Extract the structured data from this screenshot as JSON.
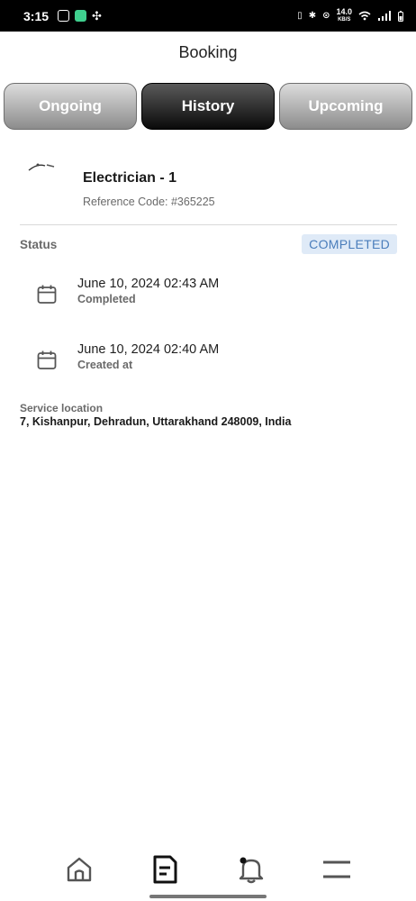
{
  "status_bar": {
    "time": "3:15",
    "speed_value": "14.0",
    "speed_unit": "KB/S"
  },
  "header": {
    "title": "Booking"
  },
  "tabs": [
    {
      "label": "Ongoing",
      "active": false
    },
    {
      "label": "History",
      "active": true
    },
    {
      "label": "Upcoming",
      "active": false
    }
  ],
  "service": {
    "name": "Electrician - 1",
    "reference": "Reference Code: #365225"
  },
  "status": {
    "label": "Status",
    "badge": "COMPLETED",
    "badge_bg": "#dfeaf7",
    "badge_color": "#4a7dbb"
  },
  "events": [
    {
      "date": "June 10, 2024 02:43 AM",
      "label": "Completed",
      "icon": "calendar-icon"
    },
    {
      "date": "June 10, 2024 02:40 AM",
      "label": "Created at",
      "icon": "calendar-icon"
    }
  ],
  "location": {
    "label": "Service location",
    "value": "7, Kishanpur, Dehradun, Uttarakhand 248009, India"
  },
  "bottom_nav": [
    {
      "name": "home",
      "icon": "home-icon"
    },
    {
      "name": "bookings",
      "icon": "document-icon",
      "active": true
    },
    {
      "name": "notifications",
      "icon": "bell-icon"
    },
    {
      "name": "menu",
      "icon": "menu-icon"
    }
  ]
}
